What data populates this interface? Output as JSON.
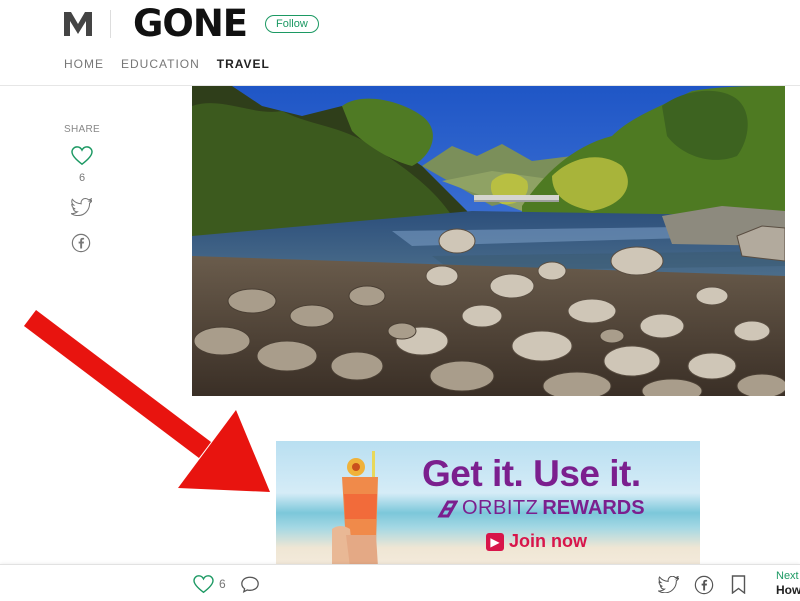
{
  "header": {
    "publication": "GONE",
    "follow_label": "Follow",
    "nav": [
      "HOME",
      "EDUCATION",
      "TRAVEL"
    ],
    "active_nav": "TRAVEL"
  },
  "share_rail": {
    "label": "SHARE",
    "likes": "6"
  },
  "ad": {
    "headline": "Get it. Use it.",
    "brand_prefix": "ORBITZ",
    "brand_suffix": "REWARDS",
    "cta": "Join now"
  },
  "bottom_bar": {
    "likes": "6",
    "next_label": "Next",
    "next_title": "How"
  },
  "colors": {
    "accent_green": "#1c9963",
    "ad_purple": "#7b1f8e",
    "ad_pink": "#d8154a",
    "arrow_red": "#e8140f"
  },
  "icons": [
    "medium-logo-icon",
    "heart-icon",
    "twitter-icon",
    "facebook-icon",
    "comment-icon",
    "bookmark-icon",
    "play-icon"
  ]
}
